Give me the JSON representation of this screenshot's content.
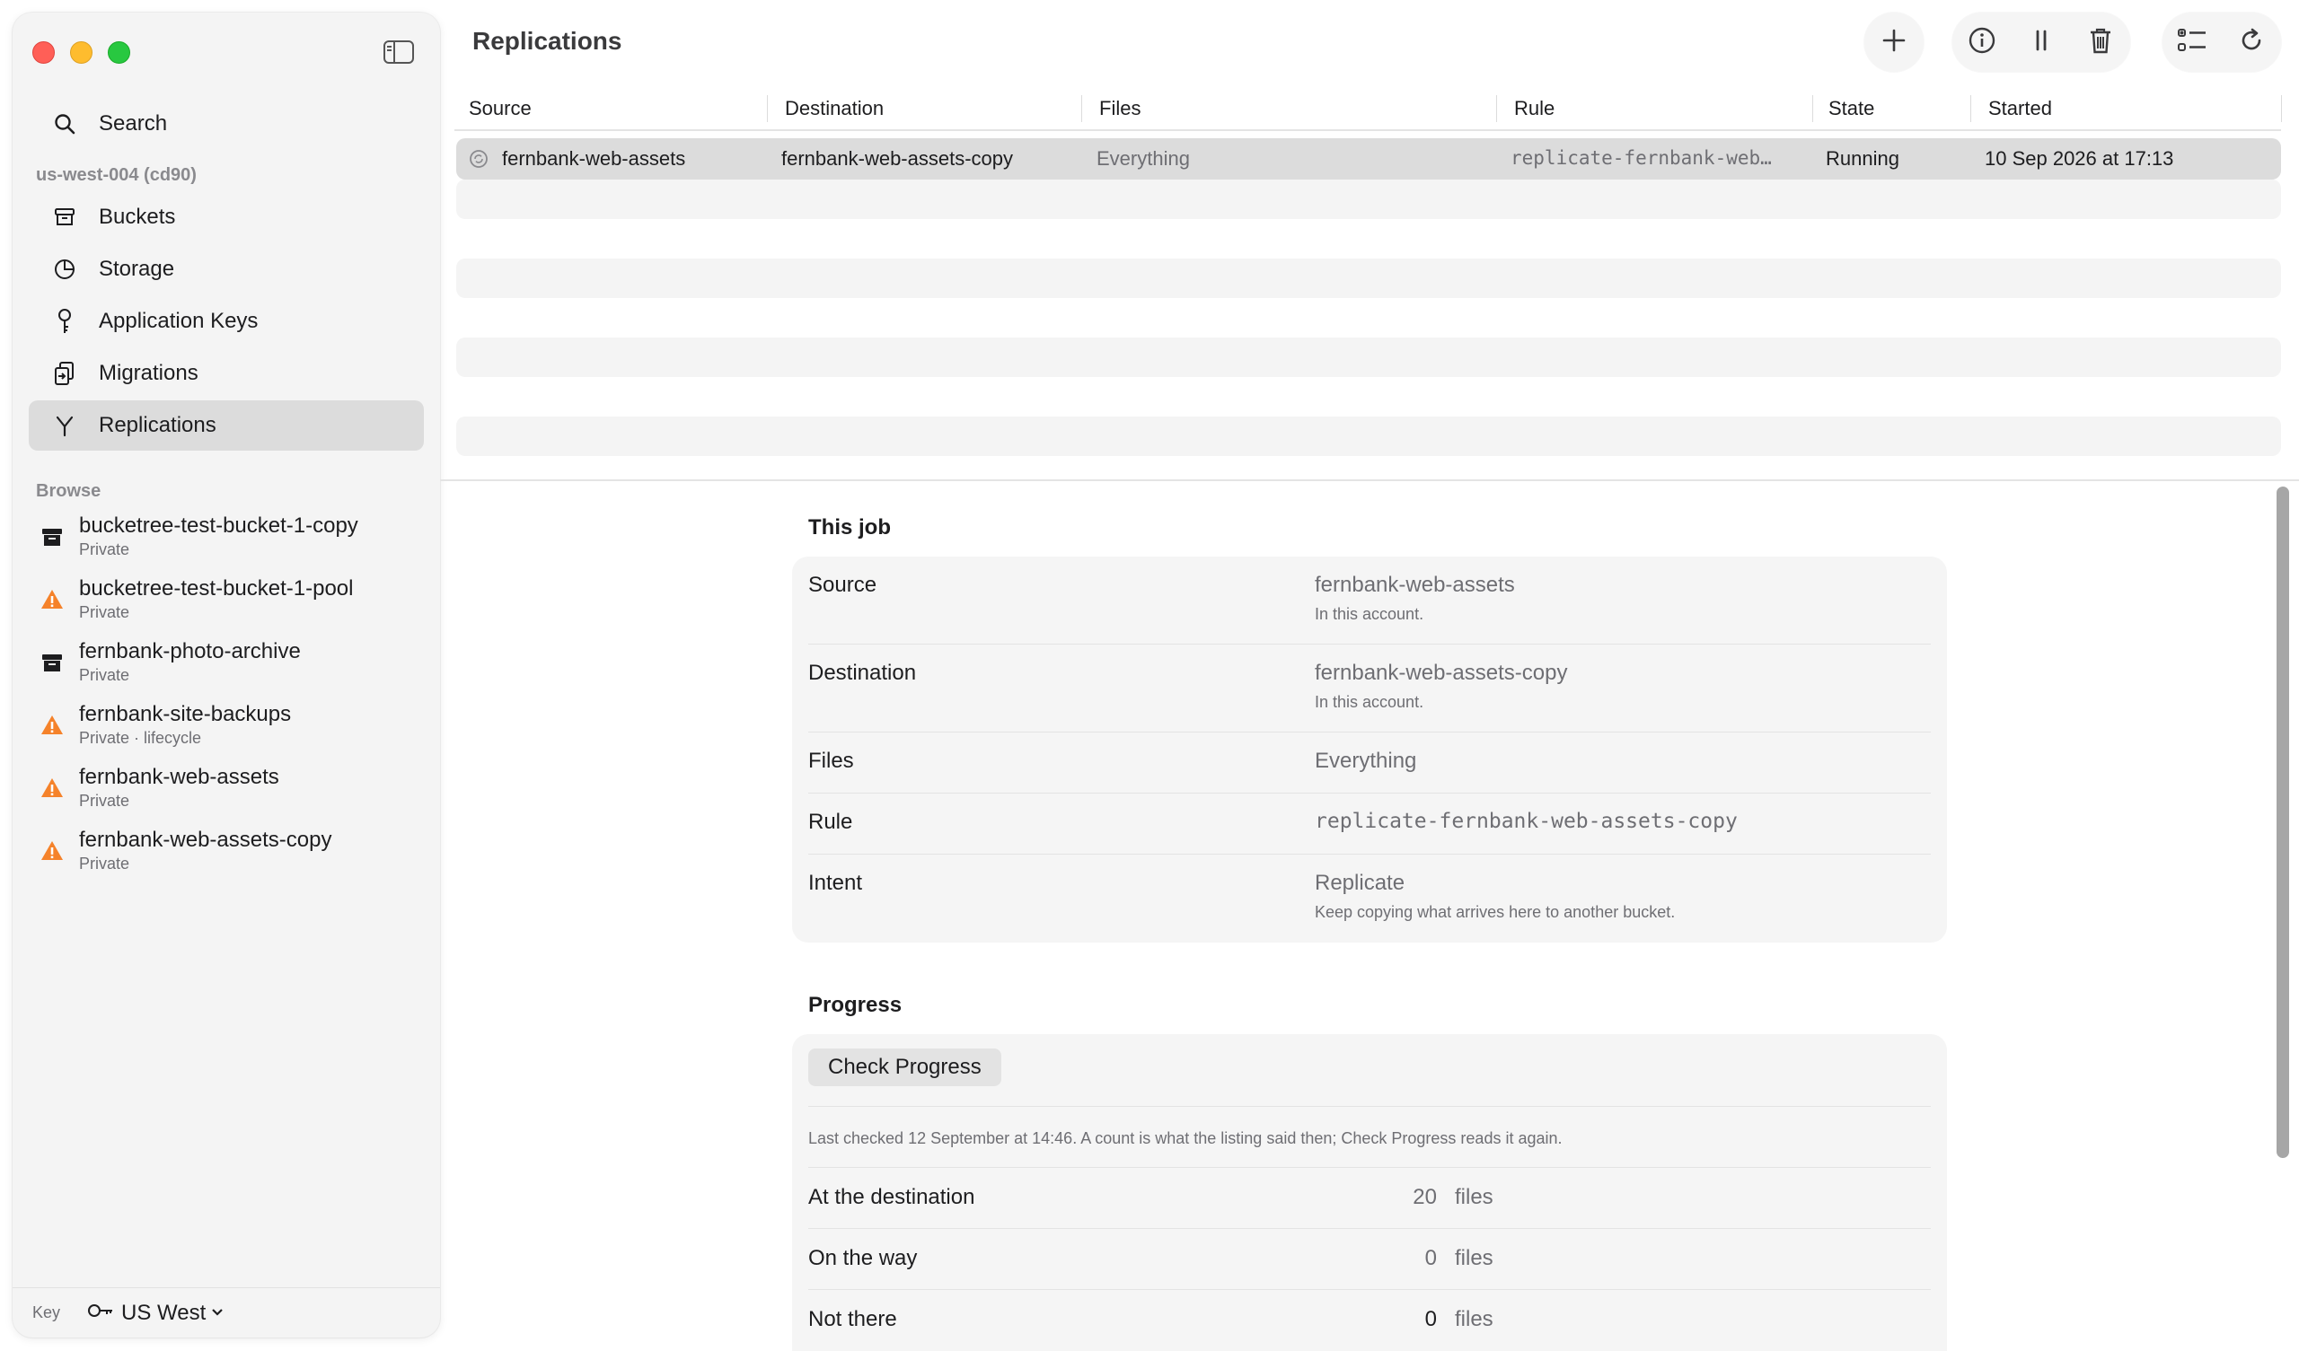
{
  "window": {
    "title": "Replications"
  },
  "sidebar": {
    "search_label": "Search",
    "account_label": "us-west-004 (cd90)",
    "nav": [
      {
        "label": "Buckets",
        "icon": "archive-box-icon"
      },
      {
        "label": "Storage",
        "icon": "pie-chart-icon"
      },
      {
        "label": "Application Keys",
        "icon": "key-icon"
      },
      {
        "label": "Migrations",
        "icon": "migrate-icon"
      },
      {
        "label": "Replications",
        "icon": "branch-icon",
        "selected": true
      }
    ],
    "browse_label": "Browse",
    "buckets": [
      {
        "name": "bucketree-test-bucket-1-copy",
        "sub": "Private",
        "icon": "archive-box-icon"
      },
      {
        "name": "bucketree-test-bucket-1-pool",
        "sub": "Private",
        "icon": "warning-icon"
      },
      {
        "name": "fernbank-photo-archive",
        "sub": "Private",
        "icon": "archive-box-icon"
      },
      {
        "name": "fernbank-site-backups",
        "sub": "Private · lifecycle",
        "icon": "warning-icon"
      },
      {
        "name": "fernbank-web-assets",
        "sub": "Private",
        "icon": "warning-icon"
      },
      {
        "name": "fernbank-web-assets-copy",
        "sub": "Private",
        "icon": "warning-icon"
      }
    ],
    "footer": {
      "key_label": "Key",
      "region": "US West"
    }
  },
  "table": {
    "headers": [
      "Source",
      "Destination",
      "Files",
      "Rule",
      "State",
      "Started"
    ],
    "rows": [
      {
        "source": "fernbank-web-assets",
        "destination": "fernbank-web-assets-copy",
        "files": "Everything",
        "rule": "replicate-fernbank-web…",
        "state": "Running",
        "started": "10 Sep 2026 at 17:13"
      }
    ]
  },
  "detail": {
    "job_title": "This job",
    "job": {
      "source_label": "Source",
      "source_value": "fernbank-web-assets",
      "source_sub": "In this account.",
      "destination_label": "Destination",
      "destination_value": "fernbank-web-assets-copy",
      "destination_sub": "In this account.",
      "files_label": "Files",
      "files_value": "Everything",
      "rule_label": "Rule",
      "rule_value": "replicate-fernbank-web-assets-copy",
      "intent_label": "Intent",
      "intent_value": "Replicate",
      "intent_sub": "Keep copying what arrives here to another bucket."
    },
    "progress_title": "Progress",
    "progress": {
      "check_button": "Check Progress",
      "note": "Last checked 12 September at 14:46. A count is what the listing said then; Check Progress reads it again.",
      "rows": [
        {
          "label": "At the destination",
          "count": "20",
          "unit": "files"
        },
        {
          "label": "On the way",
          "count": "0",
          "unit": "files"
        },
        {
          "label": "Not there",
          "count": "0",
          "unit": "files"
        }
      ]
    }
  },
  "colors": {
    "warning": "#f5822a",
    "selected_row": "#dcdcdc",
    "sidebar_bg": "#f4f4f4"
  }
}
